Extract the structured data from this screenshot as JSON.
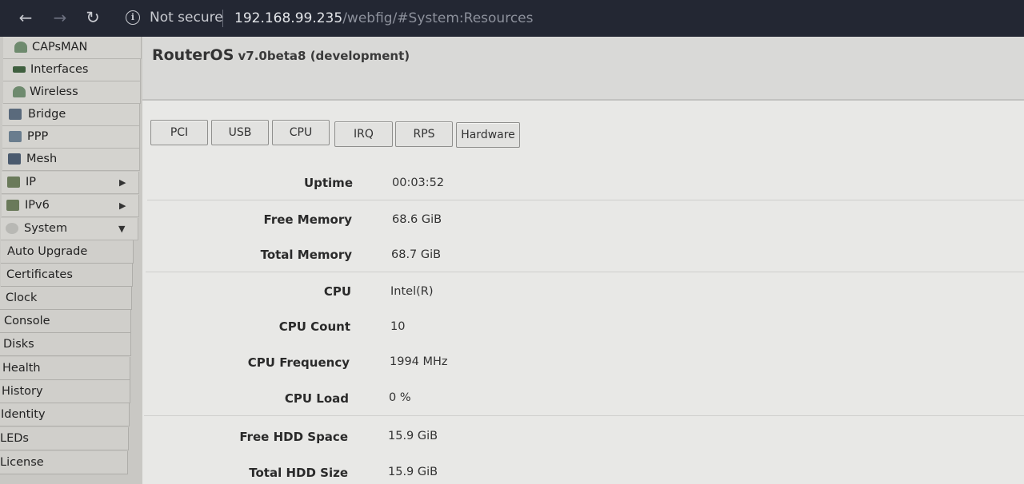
{
  "browser": {
    "back_icon": "arrow-left-icon",
    "forward_icon": "arrow-right-icon",
    "reload_icon": "reload-icon",
    "security_label": "Not secure",
    "url_host": "192.168.99.235",
    "url_path": "/webfig/#System:Resources"
  },
  "sidebar": {
    "items": [
      {
        "label": "CAPsMAN",
        "icon": "capsman-icon"
      },
      {
        "label": "Interfaces",
        "icon": "interfaces-icon"
      },
      {
        "label": "Wireless",
        "icon": "wireless-icon"
      },
      {
        "label": "Bridge",
        "icon": "bridge-icon"
      },
      {
        "label": "PPP",
        "icon": "ppp-icon"
      },
      {
        "label": "Mesh",
        "icon": "mesh-icon"
      },
      {
        "label": "IP",
        "icon": "ip-icon",
        "arrow": "▶"
      },
      {
        "label": "IPv6",
        "icon": "ipv6-icon",
        "arrow": "▶"
      },
      {
        "label": "System",
        "icon": "system-icon",
        "arrow": "▼"
      }
    ],
    "submenu": [
      "Auto Upgrade",
      "Certificates",
      "Clock",
      "Console",
      "Disks",
      "Health",
      "History",
      "Identity",
      "LEDs",
      "License"
    ]
  },
  "header": {
    "brand": "RouterOS",
    "version": "v7.0beta8 (development)"
  },
  "tabs": [
    "PCI",
    "USB",
    "CPU",
    "IRQ",
    "RPS",
    "Hardware"
  ],
  "resources": [
    {
      "label": "Uptime",
      "value": "00:03:52"
    },
    {
      "label": "Free Memory",
      "value": "68.6 GiB"
    },
    {
      "label": "Total Memory",
      "value": "68.7 GiB"
    },
    {
      "label": "CPU",
      "value": "Intel(R)"
    },
    {
      "label": "CPU Count",
      "value": "10"
    },
    {
      "label": "CPU Frequency",
      "value": "1994 MHz"
    },
    {
      "label": "CPU Load",
      "value": "0 %"
    },
    {
      "label": "Free HDD Space",
      "value": "15.9 GiB"
    },
    {
      "label": "Total HDD Size",
      "value": "15.9 GiB"
    }
  ]
}
